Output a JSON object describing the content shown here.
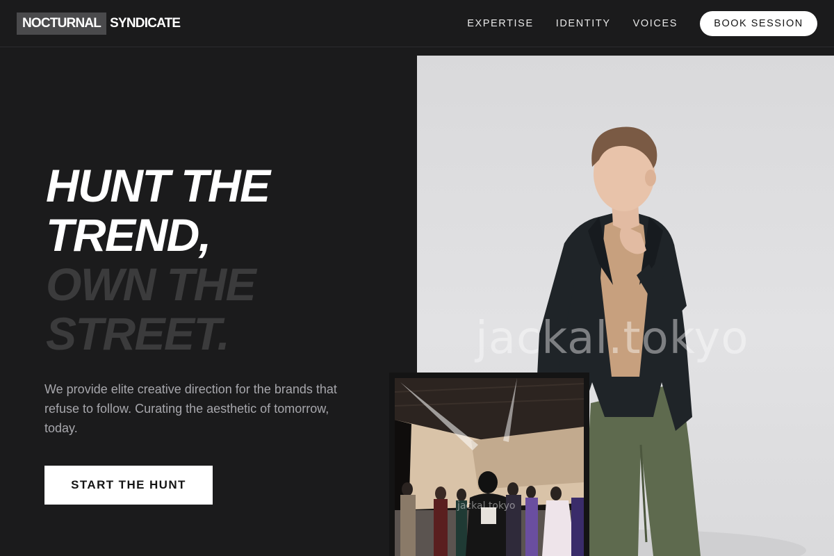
{
  "brand": {
    "logo_box_text": "NOCTURNAL",
    "logo_rest_text": "SYNDICATE"
  },
  "nav": {
    "items": [
      {
        "label": "EXPERTISE"
      },
      {
        "label": "IDENTITY"
      },
      {
        "label": "VOICES"
      }
    ],
    "cta_label": "BOOK SESSION"
  },
  "hero": {
    "headline_white": [
      "HUNT THE",
      "TREND,"
    ],
    "headline_grey": [
      "OWN THE",
      "STREET."
    ],
    "lede": "We provide elite creative direction for the brands that refuse to follow. Curating the aesthetic of tomorrow, today.",
    "cta_label": "START THE HUNT"
  },
  "photos": {
    "main_watermark": "jackal.tokyo",
    "inset_watermark": "jackal.tokyo"
  },
  "colors": {
    "background": "#1b1b1c",
    "headline_grey": "#3b3b3c",
    "lede_text": "#a7a7ac",
    "button_bg": "#ffffff",
    "button_text": "#141414"
  }
}
